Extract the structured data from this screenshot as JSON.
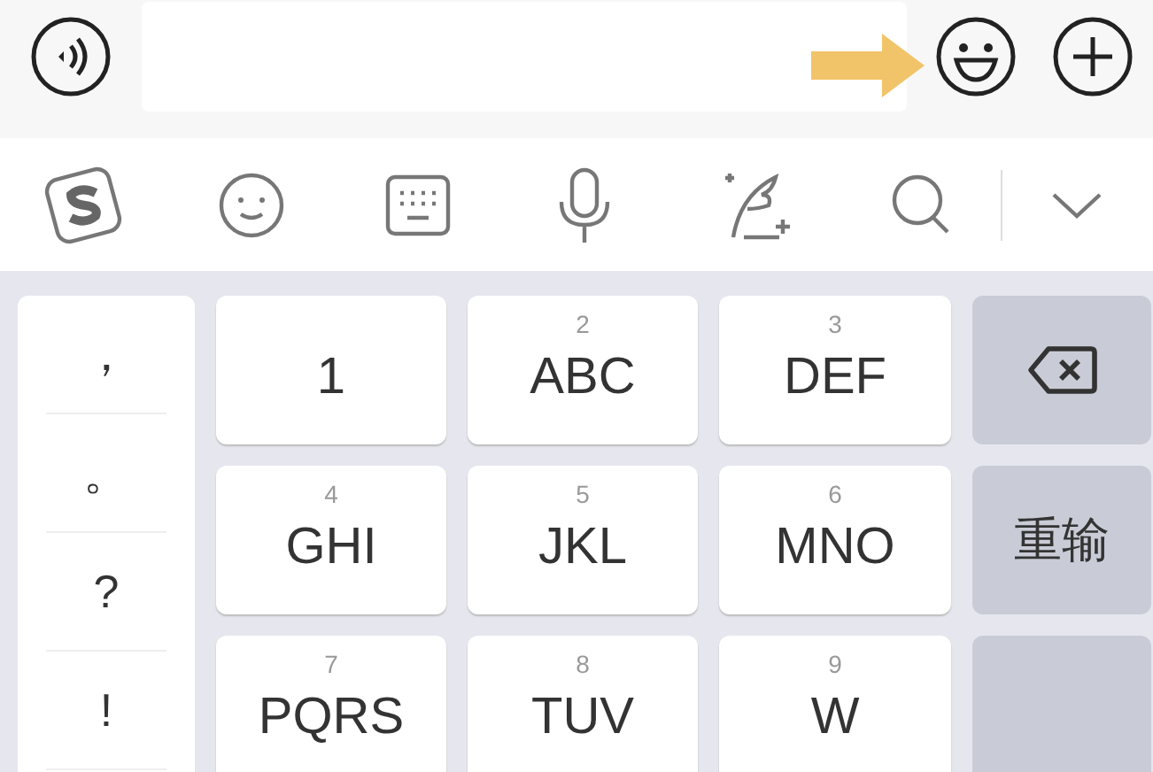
{
  "symbols": [
    "，",
    "。",
    "?",
    "!"
  ],
  "key_rows": [
    [
      {
        "label": "1"
      },
      {
        "digit": "2",
        "label": "ABC"
      },
      {
        "digit": "3",
        "label": "DEF"
      }
    ],
    [
      {
        "digit": "4",
        "label": "GHI"
      },
      {
        "digit": "5",
        "label": "JKL"
      },
      {
        "digit": "6",
        "label": "MNO"
      }
    ],
    [
      {
        "digit": "7",
        "label": "PQRS"
      },
      {
        "digit": "8",
        "label": "TUV"
      },
      {
        "digit": "9",
        "label": "W"
      }
    ]
  ],
  "function_keys": [
    {
      "kind": "delete"
    },
    {
      "kind": "text",
      "label": "重输"
    },
    {
      "kind": "blank"
    }
  ]
}
